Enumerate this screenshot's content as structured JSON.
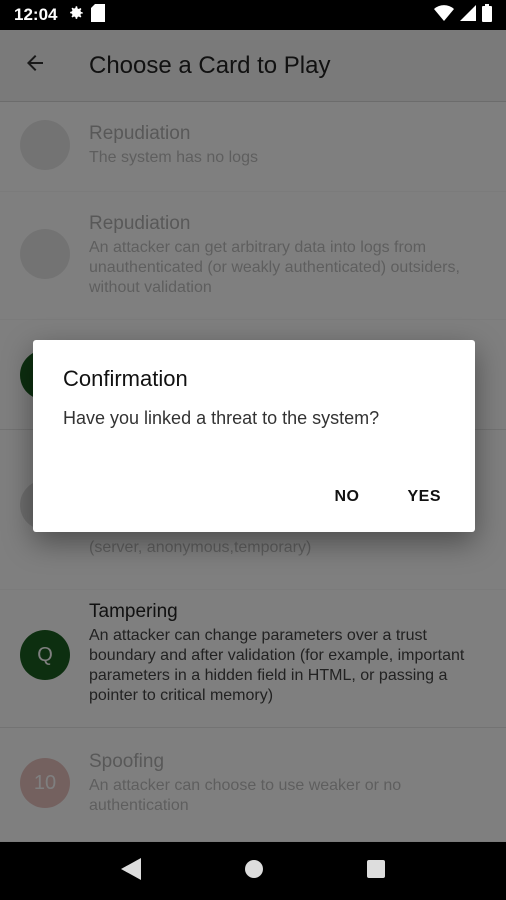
{
  "status_bar": {
    "time": "12:04"
  },
  "app_bar": {
    "title": "Choose a Card to Play"
  },
  "cards": [
    {
      "avatar": "",
      "color": "#bdbdbd",
      "title": "Repudiation",
      "description": "The system has no logs"
    },
    {
      "avatar": "",
      "color": "#bdbdbd",
      "title": "Repudiation",
      "description": "An attacker can get arbitrary data into logs from unauthenticated (or weakly authenticated) outsiders, without validation"
    },
    {
      "avatar": "",
      "color": "#1b5e20",
      "title": "",
      "description": ""
    },
    {
      "avatar": "",
      "color": "#9e9e9e",
      "title": "",
      "description": "(server, anonymous,temporary)"
    },
    {
      "avatar": "Q",
      "color": "#1b5e20",
      "title": "Tampering",
      "description": "An attacker can change parameters over a trust boundary and after validation (for example, important parameters in a hidden field in HTML, or passing a pointer to critical memory)"
    },
    {
      "avatar": "10",
      "color": "#c0524a",
      "title": "Spoofing",
      "description": "An attacker can choose to use weaker or no authentication"
    }
  ],
  "dialog": {
    "title": "Confirmation",
    "message": "Have you linked a threat to the system?",
    "no_label": "NO",
    "yes_label": "YES"
  }
}
